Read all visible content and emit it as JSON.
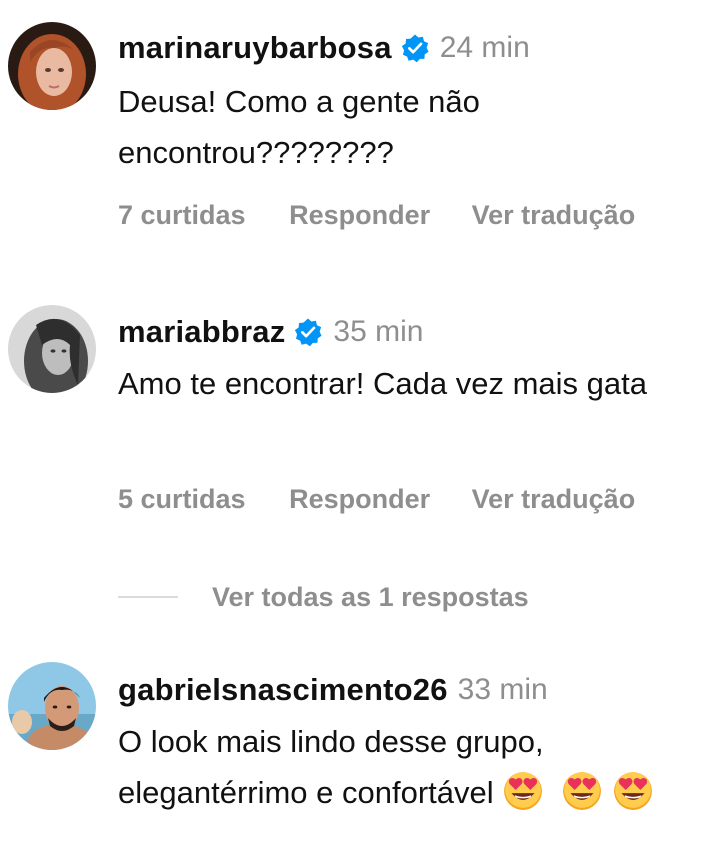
{
  "comments": [
    {
      "username": "marinaruybarbosa",
      "verified": true,
      "time": "24 min",
      "text": "Deusa! Como a gente não encontrou????????",
      "likes": "7 curtidas",
      "reply": "Responder",
      "translate": "Ver tradução"
    },
    {
      "username": "mariabbraz",
      "verified": true,
      "time": "35 min",
      "text": "Amo te encontrar! Cada vez mais gata",
      "likes": "5 curtidas",
      "reply": "Responder",
      "translate": "Ver tradução"
    },
    {
      "username": "gabrielsnascimento26",
      "verified": false,
      "time": "33 min",
      "text": "O look mais lindo desse grupo, elegantérrimo e confortável",
      "emoji": [
        "smiling-face-with-heart-eyes",
        "smiling-face-with-heart-eyes",
        "smiling-face-with-heart-eyes"
      ]
    }
  ],
  "view_replies": "Ver todas as 1 respostas",
  "colors": {
    "text": "#111111",
    "muted": "#8e8e8e",
    "verified": "#0095f6",
    "divider": "#dbdbdb"
  }
}
